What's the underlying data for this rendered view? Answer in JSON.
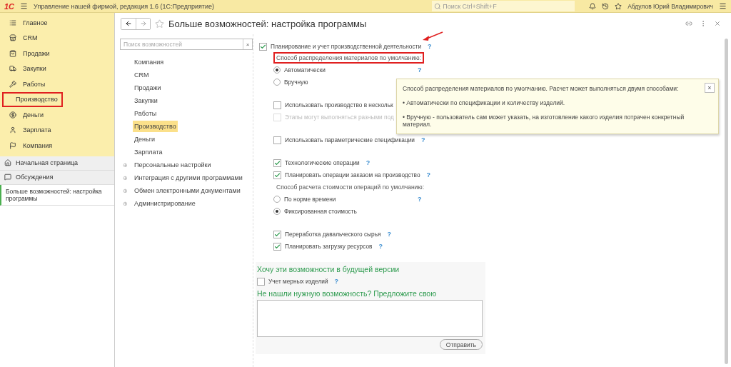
{
  "topbar": {
    "logo": "1С",
    "app_title": "Управление нашей фирмой, редакция 1.6  (1С:Предприятие)",
    "search_placeholder": "Поиск Ctrl+Shift+F",
    "user": "Абдулов Юрий Владимирович"
  },
  "sidebar": {
    "sections": [
      {
        "label": "Главное",
        "highlighted": false
      },
      {
        "label": "CRM",
        "highlighted": false
      },
      {
        "label": "Продажи",
        "highlighted": false
      },
      {
        "label": "Закупки",
        "highlighted": false
      },
      {
        "label": "Работы",
        "highlighted": false
      },
      {
        "label": "Производство",
        "highlighted": true
      },
      {
        "label": "Деньги",
        "highlighted": false
      },
      {
        "label": "Зарплата",
        "highlighted": false
      },
      {
        "label": "Компания",
        "highlighted": false
      }
    ],
    "nav": [
      {
        "kind": "home",
        "label": "Начальная страница"
      },
      {
        "kind": "chat",
        "label": "Обсуждения"
      }
    ],
    "open_windows": [
      {
        "label": "Больше возможностей: настройка программы",
        "selected": true
      }
    ]
  },
  "page": {
    "title": "Больше возможностей: настройка программы",
    "search_placeholder": "Поиск возможностей",
    "search_clear": "×",
    "expand_mark": "⊕",
    "tree": [
      {
        "label": "Компания",
        "selected": false,
        "expandable": false
      },
      {
        "label": "CRM",
        "selected": false,
        "expandable": false
      },
      {
        "label": "Продажи",
        "selected": false,
        "expandable": false
      },
      {
        "label": "Закупки",
        "selected": false,
        "expandable": false
      },
      {
        "label": "Работы",
        "selected": false,
        "expandable": false
      },
      {
        "label": "Производство",
        "selected": true,
        "expandable": false
      },
      {
        "label": "Деньги",
        "selected": false,
        "expandable": false
      },
      {
        "label": "Зарплата",
        "selected": false,
        "expandable": false
      },
      {
        "label": "Персональные настройки",
        "selected": false,
        "expandable": true
      },
      {
        "label": "Интеграция с другими программами",
        "selected": false,
        "expandable": true
      },
      {
        "label": "Обмен электронными документами",
        "selected": false,
        "expandable": true
      },
      {
        "label": "Администрирование",
        "selected": false,
        "expandable": true
      }
    ],
    "setting": {
      "kind": "checkbox",
      "label": "Планирование и учет производственной деятельности",
      "checked": true,
      "disabled": false,
      "help": true,
      "groups": [
        {
          "items": [
            {
              "kind": "caption",
              "label": "Способ распределения материалов по умолчанию:",
              "highlighted": true,
              "help": false
            },
            {
              "kind": "radio",
              "label": "Автоматически",
              "selected": true,
              "disabled": false,
              "help": true
            },
            {
              "kind": "radio",
              "label": "Вручную",
              "selected": false,
              "disabled": false,
              "help": false
            }
          ]
        },
        {
          "items": [
            {
              "kind": "checkbox",
              "label": "Использовать производство в нескольк",
              "checked": false,
              "disabled": false,
              "help": false
            },
            {
              "kind": "checkbox",
              "label": "Этапы могут выполняться разными под",
              "checked": false,
              "disabled": true,
              "help": false
            }
          ]
        },
        {
          "items": [
            {
              "kind": "checkbox",
              "label": "Использовать параметрические спецификации",
              "checked": false,
              "disabled": false,
              "help": true
            }
          ]
        },
        {
          "items": [
            {
              "kind": "checkbox",
              "label": "Технологические операции",
              "checked": true,
              "disabled": false,
              "help": true
            },
            {
              "kind": "checkbox",
              "label": "Планировать операции заказом на производство",
              "checked": true,
              "disabled": false,
              "help": true
            },
            {
              "kind": "caption",
              "label": "Способ расчета стоимости операций по умолчанию:",
              "highlighted": false,
              "help": false
            },
            {
              "kind": "radio",
              "label": "По норме времени",
              "selected": false,
              "disabled": false,
              "help": true
            },
            {
              "kind": "radio",
              "label": "Фиксированная стоимость",
              "selected": true,
              "disabled": false,
              "help": false
            }
          ]
        },
        {
          "items": [
            {
              "kind": "checkbox",
              "label": "Переработка давальческого сырья",
              "checked": true,
              "disabled": false,
              "help": true
            },
            {
              "kind": "checkbox",
              "label": "Планировать загрузку ресурсов",
              "checked": true,
              "disabled": false,
              "help": true
            }
          ]
        }
      ]
    },
    "future": {
      "title": "Хочу эти возможности в будущей версии",
      "items": [
        {
          "label": "Учет мерных изделий",
          "checked": false,
          "help": true
        }
      ],
      "suggest_title": "Не нашли нужную возможность? Предложите свою",
      "button": "Отправить"
    },
    "tooltip": {
      "text": "Способ распределения материалов по умолчанию. Расчет может выполняться двумя способами:",
      "bullets": [
        "• Автоматически по спецификации и количеству изделий.",
        "• Вручную - пользователь сам может указать, на изготовление какого изделия потрачен конкретный материал."
      ],
      "close": "×"
    },
    "help_mark": "?"
  }
}
